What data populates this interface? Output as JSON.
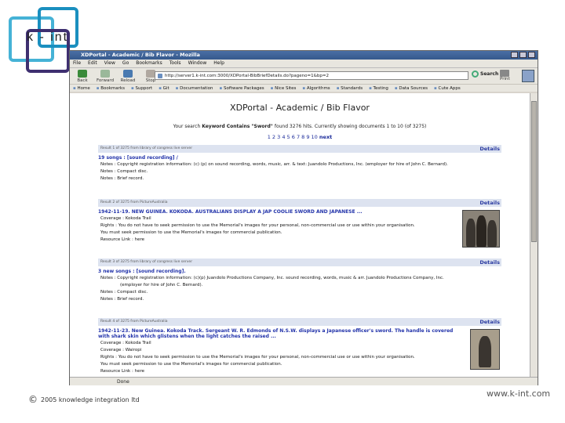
{
  "logo": {
    "text": "k - int"
  },
  "footer": {
    "copyright_symbol": "©",
    "copyright": "2005 knowledge integration ltd",
    "website": "www.k-int.com"
  },
  "browser": {
    "title": "XDPortal - Academic / Bib Flavor - Mozilla",
    "menu": [
      "File",
      "Edit",
      "View",
      "Go",
      "Bookmarks",
      "Tools",
      "Window",
      "Help"
    ],
    "nav": {
      "back": "Back",
      "forward": "Forward",
      "reload": "Reload",
      "stop": "Stop",
      "print": "Print",
      "search": "Search"
    },
    "url": "http://server1.k-int.com:3000/XDPortal-BibBriefDetails.do?pageno=1&bp=2",
    "bookmarks": [
      "Home",
      "Bookmarks",
      "Support",
      "Git",
      "Documentation",
      "Software Packages",
      "Nice Sites",
      "Algorithms",
      "Standards",
      "Testing",
      "Data Sources",
      "Cute Apps"
    ],
    "status": "Done"
  },
  "page": {
    "title": "XDPortal - Academic / Bib Flavor",
    "summary_prefix": "Your search ",
    "summary_query": "Keyword Contains \"Sword\"",
    "summary_suffix": " found 3276 hits. Currently showing documents 1 to 10 (of 3275)",
    "pages": "1 2 3 4 5 6 7 8 9 10",
    "next": "next",
    "details_label": "Details"
  },
  "results": [
    {
      "header": "Result 1 of 3275 from library of congress live server",
      "title": "19 songs : [sound recording] /",
      "lines": [
        "Notes : Copyright registration information: (c) (p) on sound recording, words, music, arr. & text: Juandolo Productions, Inc. (employer for hire of John C. Bernard).",
        "Notes : Compact disc.",
        "Notes : Brief record."
      ]
    },
    {
      "header": "Result 2 of 3275 from PictureAustralia",
      "title": "1942-11-19. NEW GUINEA. KOKODA. AUSTRALIANS DISPLAY A JAP COOLIE SWORD AND JAPANESE ...",
      "lines": [
        "Coverage : Kokoda Trail",
        "Rights : You do not have to seek permission to use the Memorial's images for your personal, non-commercial use or use within your organisation.",
        "You must seek permission to use the Memorial's images for commercial publication.",
        "Resource Link : here"
      ]
    },
    {
      "header": "Result 3 of 3275 from library of congress live server",
      "title": "3 new songs : [sound recording].",
      "lines": [
        "Notes : Copyright registration information: (c)(p) Juandolo Productions Company, Inc. sound recording, words, music & arr. Juandolo Productions Company, Inc.",
        "(employer for hire of John C. Bernard).",
        "Notes : Compact disc.",
        "Notes : Brief record."
      ]
    },
    {
      "header": "Result 4 of 3275 from PictureAustralia",
      "title": "1942-11-23. New Guinea. Kokoda Track. Sergeant W. R. Edmonds of N.S.W. displays a Japanese officer's sword. The handle is covered with shark skin which glistens when the light catches the raised ...",
      "lines": [
        "Coverage : Kokoda Trail",
        "Coverage : Wairopi",
        "Rights : You do not have to seek permission to use the Memorial's images for your personal, non-commercial use or use within your organisation.",
        "You must seek permission to use the Memorial's images for commercial publication.",
        "Resource Link : here"
      ]
    }
  ]
}
